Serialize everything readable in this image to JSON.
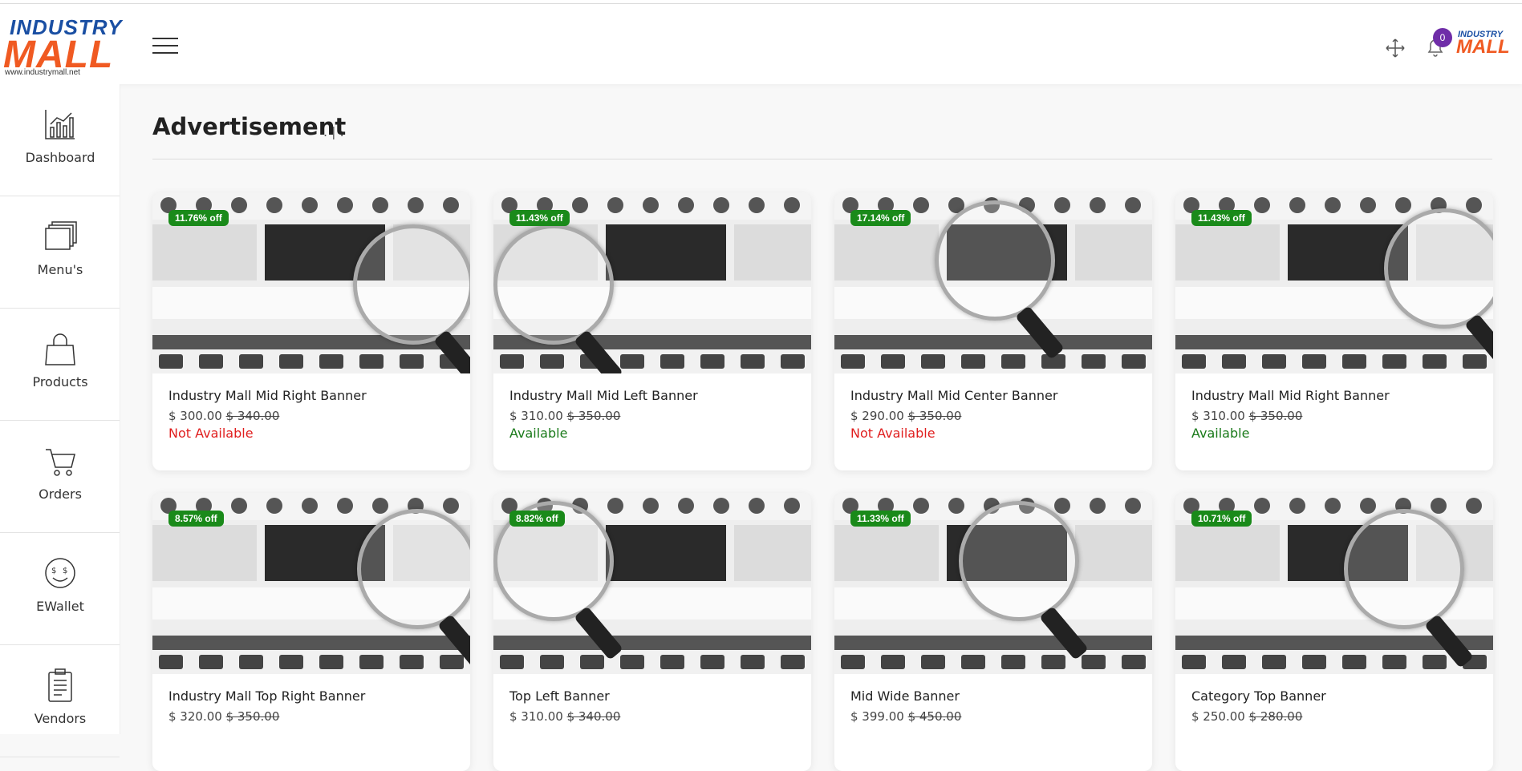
{
  "brand": {
    "logo_top": "INDUSTRY",
    "logo_main": "MALL",
    "logo_url": "www.industrymall.net",
    "accent": "#f05a22",
    "secondary": "#1a4fa3"
  },
  "header": {
    "notifications_count": "0",
    "avatar_top": "INDUSTRY",
    "avatar_main": "MALL"
  },
  "sidebar": {
    "items": [
      {
        "label": "Dashboard",
        "icon": "chart-icon"
      },
      {
        "label": "Menu's",
        "icon": "menus-icon"
      },
      {
        "label": "Products",
        "icon": "bag-icon"
      },
      {
        "label": "Orders",
        "icon": "cart-icon"
      },
      {
        "label": "EWallet",
        "icon": "wallet-icon"
      },
      {
        "label": "Vendors",
        "icon": "clipboard-icon"
      }
    ]
  },
  "main": {
    "title": "Advertisement",
    "breadcrumb": ". | ."
  },
  "cards": [
    {
      "discount": "11.76% off",
      "title": "Industry Mall Mid Right Banner",
      "price": "$ 300.00",
      "old_price": "$ 340.00",
      "status": "Not Available",
      "available": false
    },
    {
      "discount": "11.43% off",
      "title": "Industry Mall Mid Left Banner",
      "price": "$ 310.00",
      "old_price": "$ 350.00",
      "status": "Available",
      "available": true
    },
    {
      "discount": "17.14% off",
      "title": "Industry Mall Mid Center Banner",
      "price": "$ 290.00",
      "old_price": "$ 350.00",
      "status": "Not Available",
      "available": false
    },
    {
      "discount": "11.43% off",
      "title": "Industry Mall Mid Right Banner",
      "price": "$ 310.00",
      "old_price": "$ 350.00",
      "status": "Available",
      "available": true
    },
    {
      "discount": "8.57% off",
      "title": "Industry Mall Top Right Banner",
      "price": "$ 320.00",
      "old_price": "$ 350.00",
      "status": "",
      "available": true
    },
    {
      "discount": "8.82% off",
      "title": "Top Left Banner",
      "price": "$ 310.00",
      "old_price": "$ 340.00",
      "status": "",
      "available": false
    },
    {
      "discount": "11.33% off",
      "title": "Mid Wide Banner",
      "price": "$ 399.00",
      "old_price": "$ 450.00",
      "status": "",
      "available": true
    },
    {
      "discount": "10.71% off",
      "title": "Category Top Banner",
      "price": "$ 250.00",
      "old_price": "$ 280.00",
      "status": "",
      "available": true
    }
  ]
}
